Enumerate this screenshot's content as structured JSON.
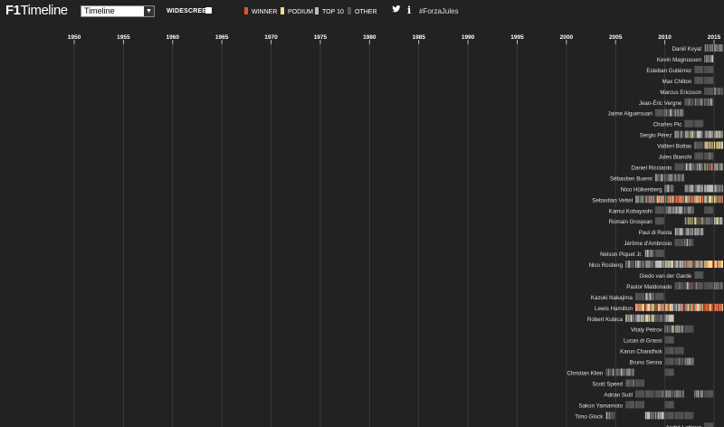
{
  "app": {
    "logo_f1": "F1",
    "logo_rest": "Timeline",
    "view_select": "Timeline",
    "widescreen_label": "WIDESCREEN",
    "hashtag": "#ForzaJules",
    "info_glyph": "i",
    "legend": [
      {
        "label": "WINNER",
        "color": "#e8502a"
      },
      {
        "label": "PODIUM",
        "color": "#f5dc8a"
      },
      {
        "label": "TOP 10",
        "color": "#bdbdbd"
      },
      {
        "label": "OTHER",
        "color": "#555555"
      }
    ]
  },
  "chart_data": {
    "type": "timeline",
    "x_ticks": [
      "1950",
      "1955",
      "1960",
      "1965",
      "1970",
      "1975",
      "1980",
      "1985",
      "1990",
      "1995",
      "2000",
      "2005",
      "2010",
      "2015"
    ],
    "x_range": [
      1950,
      2015
    ],
    "categories_legend": {
      "winner": "#e8502a",
      "podium": "#f5dc8a",
      "top10": "#bdbdbd",
      "other": "#555555"
    },
    "drivers": [
      {
        "name": "Daniil Kvyat",
        "seasons": [
          [
            2014,
            0.2,
            0.0,
            0.0
          ],
          [
            2015,
            0.3,
            0.05,
            0.0
          ]
        ]
      },
      {
        "name": "Kevin Magnussen",
        "seasons": [
          [
            2014,
            0.3,
            0.05,
            0.0
          ]
        ]
      },
      {
        "name": "Esteban Gutiérrez",
        "seasons": [
          [
            2013,
            0.05,
            0.0,
            0.0
          ],
          [
            2014,
            0.0,
            0.0,
            0.0
          ]
        ]
      },
      {
        "name": "Max Chilton",
        "seasons": [
          [
            2013,
            0.0,
            0.0,
            0.0
          ],
          [
            2014,
            0.0,
            0.0,
            0.0
          ]
        ]
      },
      {
        "name": "Marcus Ericsson",
        "seasons": [
          [
            2014,
            0.0,
            0.0,
            0.0
          ],
          [
            2015,
            0.2,
            0.0,
            0.0
          ]
        ]
      },
      {
        "name": "Jean-Éric Vergne",
        "seasons": [
          [
            2012,
            0.2,
            0.0,
            0.0
          ],
          [
            2013,
            0.15,
            0.0,
            0.0
          ],
          [
            2014,
            0.3,
            0.0,
            0.0
          ]
        ]
      },
      {
        "name": "Jaime Alguersuari",
        "seasons": [
          [
            2009,
            0.0,
            0.0,
            0.0
          ],
          [
            2010,
            0.25,
            0.0,
            0.0
          ],
          [
            2011,
            0.35,
            0.0,
            0.0
          ]
        ]
      },
      {
        "name": "Charles Pic",
        "seasons": [
          [
            2012,
            0.0,
            0.0,
            0.0
          ],
          [
            2013,
            0.0,
            0.0,
            0.0
          ]
        ]
      },
      {
        "name": "Sergio Pérez",
        "seasons": [
          [
            2011,
            0.3,
            0.0,
            0.0
          ],
          [
            2012,
            0.35,
            0.15,
            0.0
          ],
          [
            2013,
            0.4,
            0.0,
            0.0
          ],
          [
            2014,
            0.5,
            0.05,
            0.0
          ],
          [
            2015,
            0.5,
            0.05,
            0.0
          ]
        ]
      },
      {
        "name": "Valtteri Bottas",
        "seasons": [
          [
            2013,
            0.1,
            0.0,
            0.0
          ],
          [
            2014,
            0.6,
            0.3,
            0.0
          ],
          [
            2015,
            0.6,
            0.3,
            0.0
          ]
        ]
      },
      {
        "name": "Jules Bianchi",
        "seasons": [
          [
            2013,
            0.0,
            0.0,
            0.0
          ],
          [
            2014,
            0.05,
            0.0,
            0.0
          ]
        ]
      },
      {
        "name": "Daniel Ricciardo",
        "seasons": [
          [
            2011,
            0.0,
            0.0,
            0.0
          ],
          [
            2012,
            0.2,
            0.0,
            0.0
          ],
          [
            2013,
            0.35,
            0.0,
            0.0
          ],
          [
            2014,
            0.6,
            0.4,
            0.15
          ],
          [
            2015,
            0.5,
            0.1,
            0.0
          ]
        ]
      },
      {
        "name": "Sébastien Buemi",
        "seasons": [
          [
            2009,
            0.25,
            0.0,
            0.0
          ],
          [
            2010,
            0.15,
            0.0,
            0.0
          ],
          [
            2011,
            0.3,
            0.0,
            0.0
          ]
        ]
      },
      {
        "name": "Nico Hülkenberg",
        "seasons": [
          [
            2010,
            0.4,
            0.0,
            0.0
          ],
          [
            2012,
            0.5,
            0.0,
            0.0
          ],
          [
            2013,
            0.5,
            0.0,
            0.0
          ],
          [
            2014,
            0.7,
            0.0,
            0.0
          ],
          [
            2015,
            0.5,
            0.0,
            0.0
          ]
        ]
      },
      {
        "name": "Sebastian Vettel",
        "seasons": [
          [
            2007,
            0.3,
            0.0,
            0.0
          ],
          [
            2008,
            0.5,
            0.05,
            0.05
          ],
          [
            2009,
            0.8,
            0.6,
            0.25
          ],
          [
            2010,
            0.8,
            0.6,
            0.3
          ],
          [
            2011,
            0.95,
            0.85,
            0.55
          ],
          [
            2012,
            0.9,
            0.5,
            0.25
          ],
          [
            2013,
            0.95,
            0.8,
            0.65
          ],
          [
            2014,
            0.7,
            0.2,
            0.0
          ],
          [
            2015,
            0.8,
            0.5,
            0.15
          ]
        ]
      },
      {
        "name": "Kamui Kobayashi",
        "seasons": [
          [
            2009,
            0.1,
            0.0,
            0.0
          ],
          [
            2010,
            0.4,
            0.0,
            0.0
          ],
          [
            2011,
            0.5,
            0.0,
            0.0
          ],
          [
            2012,
            0.5,
            0.05,
            0.0
          ],
          [
            2014,
            0.0,
            0.0,
            0.0
          ]
        ]
      },
      {
        "name": "Romain Grosjean",
        "seasons": [
          [
            2009,
            0.0,
            0.0,
            0.0
          ],
          [
            2012,
            0.4,
            0.3,
            0.0
          ],
          [
            2013,
            0.5,
            0.3,
            0.0
          ],
          [
            2014,
            0.1,
            0.0,
            0.0
          ],
          [
            2015,
            0.5,
            0.05,
            0.0
          ]
        ]
      },
      {
        "name": "Paul di Resta",
        "seasons": [
          [
            2011,
            0.4,
            0.0,
            0.0
          ],
          [
            2012,
            0.5,
            0.0,
            0.0
          ],
          [
            2013,
            0.4,
            0.0,
            0.0
          ]
        ]
      },
      {
        "name": "Jérôme d'Ambrosio",
        "seasons": [
          [
            2011,
            0.0,
            0.0,
            0.0
          ],
          [
            2012,
            0.1,
            0.0,
            0.0
          ]
        ]
      },
      {
        "name": "Nelson Piquet Jr.",
        "seasons": [
          [
            2008,
            0.3,
            0.05,
            0.0
          ],
          [
            2009,
            0.0,
            0.0,
            0.0
          ]
        ]
      },
      {
        "name": "Nico Rosberg",
        "seasons": [
          [
            2006,
            0.2,
            0.0,
            0.0
          ],
          [
            2007,
            0.4,
            0.0,
            0.0
          ],
          [
            2008,
            0.4,
            0.1,
            0.0
          ],
          [
            2009,
            0.8,
            0.0,
            0.0
          ],
          [
            2010,
            0.8,
            0.15,
            0.0
          ],
          [
            2011,
            0.6,
            0.0,
            0.0
          ],
          [
            2012,
            0.4,
            0.1,
            0.05
          ],
          [
            2013,
            0.6,
            0.2,
            0.1
          ],
          [
            2014,
            0.95,
            0.8,
            0.25
          ],
          [
            2015,
            0.95,
            0.8,
            0.3
          ]
        ]
      },
      {
        "name": "Giedo van der Garde",
        "seasons": [
          [
            2013,
            0.0,
            0.0,
            0.0
          ]
        ]
      },
      {
        "name": "Pastor Maldonado",
        "seasons": [
          [
            2011,
            0.05,
            0.0,
            0.0
          ],
          [
            2012,
            0.3,
            0.05,
            0.05
          ],
          [
            2013,
            0.05,
            0.0,
            0.0
          ],
          [
            2014,
            0.05,
            0.0,
            0.0
          ],
          [
            2015,
            0.2,
            0.0,
            0.0
          ]
        ]
      },
      {
        "name": "Kazuki Nakajima",
        "seasons": [
          [
            2007,
            0.0,
            0.0,
            0.0
          ],
          [
            2008,
            0.3,
            0.0,
            0.0
          ],
          [
            2009,
            0.0,
            0.0,
            0.0
          ]
        ]
      },
      {
        "name": "Lewis Hamilton",
        "seasons": [
          [
            2007,
            1.0,
            0.75,
            0.2
          ],
          [
            2008,
            0.9,
            0.55,
            0.25
          ],
          [
            2009,
            0.6,
            0.3,
            0.1
          ],
          [
            2010,
            0.85,
            0.45,
            0.15
          ],
          [
            2011,
            0.8,
            0.35,
            0.15
          ],
          [
            2012,
            0.7,
            0.35,
            0.2
          ],
          [
            2013,
            0.9,
            0.3,
            0.05
          ],
          [
            2014,
            0.9,
            0.75,
            0.55
          ],
          [
            2015,
            0.95,
            0.85,
            0.5
          ]
        ]
      },
      {
        "name": "Robert Kubica",
        "seasons": [
          [
            2006,
            0.4,
            0.15,
            0.0
          ],
          [
            2007,
            0.75,
            0.0,
            0.0
          ],
          [
            2008,
            0.8,
            0.35,
            0.05
          ],
          [
            2009,
            0.3,
            0.05,
            0.0
          ],
          [
            2010,
            0.8,
            0.15,
            0.0
          ]
        ]
      },
      {
        "name": "Vitaly Petrov",
        "seasons": [
          [
            2010,
            0.3,
            0.0,
            0.0
          ],
          [
            2011,
            0.4,
            0.05,
            0.0
          ],
          [
            2012,
            0.0,
            0.0,
            0.0
          ]
        ]
      },
      {
        "name": "Lucas di Grassi",
        "seasons": [
          [
            2010,
            0.0,
            0.0,
            0.0
          ]
        ]
      },
      {
        "name": "Karun Chandhok",
        "seasons": [
          [
            2010,
            0.0,
            0.0,
            0.0
          ],
          [
            2011,
            0.0,
            0.0,
            0.0
          ]
        ]
      },
      {
        "name": "Bruno Senna",
        "seasons": [
          [
            2010,
            0.0,
            0.0,
            0.0
          ],
          [
            2011,
            0.2,
            0.0,
            0.0
          ],
          [
            2012,
            0.5,
            0.0,
            0.0
          ]
        ]
      },
      {
        "name": "Christian Klien",
        "seasons": [
          [
            2004,
            0.15,
            0.0,
            0.0
          ],
          [
            2005,
            0.35,
            0.0,
            0.0
          ],
          [
            2006,
            0.25,
            0.0,
            0.0
          ],
          [
            2010,
            0.0,
            0.0,
            0.0
          ]
        ]
      },
      {
        "name": "Scott Speed",
        "seasons": [
          [
            2006,
            0.1,
            0.0,
            0.0
          ],
          [
            2007,
            0.0,
            0.0,
            0.0
          ]
        ]
      },
      {
        "name": "Adrian Sutil",
        "seasons": [
          [
            2007,
            0.05,
            0.0,
            0.0
          ],
          [
            2008,
            0.0,
            0.0,
            0.0
          ],
          [
            2009,
            0.1,
            0.0,
            0.0
          ],
          [
            2010,
            0.4,
            0.0,
            0.0
          ],
          [
            2011,
            0.5,
            0.0,
            0.0
          ],
          [
            2013,
            0.4,
            0.0,
            0.0
          ],
          [
            2014,
            0.0,
            0.0,
            0.0
          ]
        ]
      },
      {
        "name": "Sakon Yamamoto",
        "seasons": [
          [
            2006,
            0.0,
            0.0,
            0.0
          ],
          [
            2007,
            0.0,
            0.0,
            0.0
          ],
          [
            2010,
            0.0,
            0.0,
            0.0
          ]
        ]
      },
      {
        "name": "Timo Glock",
        "seasons": [
          [
            2004,
            0.15,
            0.0,
            0.0
          ],
          [
            2008,
            0.5,
            0.05,
            0.0
          ],
          [
            2009,
            0.6,
            0.1,
            0.0
          ],
          [
            2010,
            0.0,
            0.0,
            0.0
          ],
          [
            2011,
            0.0,
            0.0,
            0.0
          ],
          [
            2012,
            0.0,
            0.0,
            0.0
          ]
        ]
      },
      {
        "name": "André Lotterer",
        "seasons": [
          [
            2014,
            0.0,
            0.0,
            0.0
          ]
        ]
      }
    ]
  }
}
